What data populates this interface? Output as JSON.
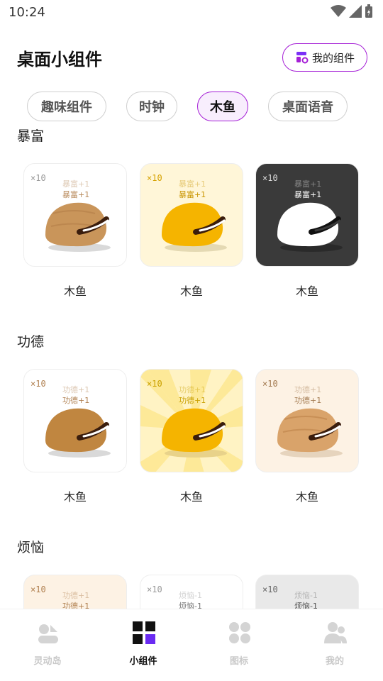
{
  "status_bar": {
    "time": "10:24"
  },
  "header": {
    "title": "桌面小组件",
    "my_widgets_label": "我的组件"
  },
  "tabs": [
    {
      "label": "趣味组件",
      "active": false
    },
    {
      "label": "时钟",
      "active": false
    },
    {
      "label": "木鱼",
      "active": true
    },
    {
      "label": "桌面语音",
      "active": false
    }
  ],
  "sections": [
    {
      "title": "暴富",
      "cards": [
        {
          "caption": "木鱼",
          "count": "×10",
          "line1": "暴富+1",
          "line2": "暴富+1",
          "style": "white-wood"
        },
        {
          "caption": "木鱼",
          "count": "×10",
          "line1": "暴富+1",
          "line2": "暴富+1",
          "style": "cream-gold"
        },
        {
          "caption": "木鱼",
          "count": "×10",
          "line1": "暴富+1",
          "line2": "暴富+1",
          "style": "dark-white"
        }
      ]
    },
    {
      "title": "功德",
      "cards": [
        {
          "caption": "木鱼",
          "count": "×10",
          "line1": "功德+1",
          "line2": "功德+1",
          "style": "white-tan"
        },
        {
          "caption": "木鱼",
          "count": "×10",
          "line1": "功德+1",
          "line2": "功德+1",
          "style": "rays-gold"
        },
        {
          "caption": "木鱼",
          "count": "×10",
          "line1": "功德+1",
          "line2": "功德+1",
          "style": "peach-wood"
        }
      ]
    },
    {
      "title": "烦恼",
      "cards": [
        {
          "count": "×10",
          "line1": "功德+1",
          "line2": "功德+1",
          "style": "peach"
        },
        {
          "count": "×10",
          "line1": "烦恼-1",
          "line2": "烦恼-1",
          "style": "white"
        },
        {
          "count": "×10",
          "line1": "烦恼-1",
          "line2": "烦恼-1",
          "style": "grey"
        }
      ]
    }
  ],
  "bottom_nav": [
    {
      "label": "灵动岛",
      "icon": "island-icon",
      "active": false
    },
    {
      "label": "小组件",
      "icon": "widgets-icon",
      "active": true
    },
    {
      "label": "图标",
      "icon": "icons-grid-icon",
      "active": false
    },
    {
      "label": "我的",
      "icon": "user-icon",
      "active": false
    }
  ],
  "colors": {
    "accent": "#a51fd6",
    "gold": "#f5b400",
    "wood": "#c9955a"
  }
}
